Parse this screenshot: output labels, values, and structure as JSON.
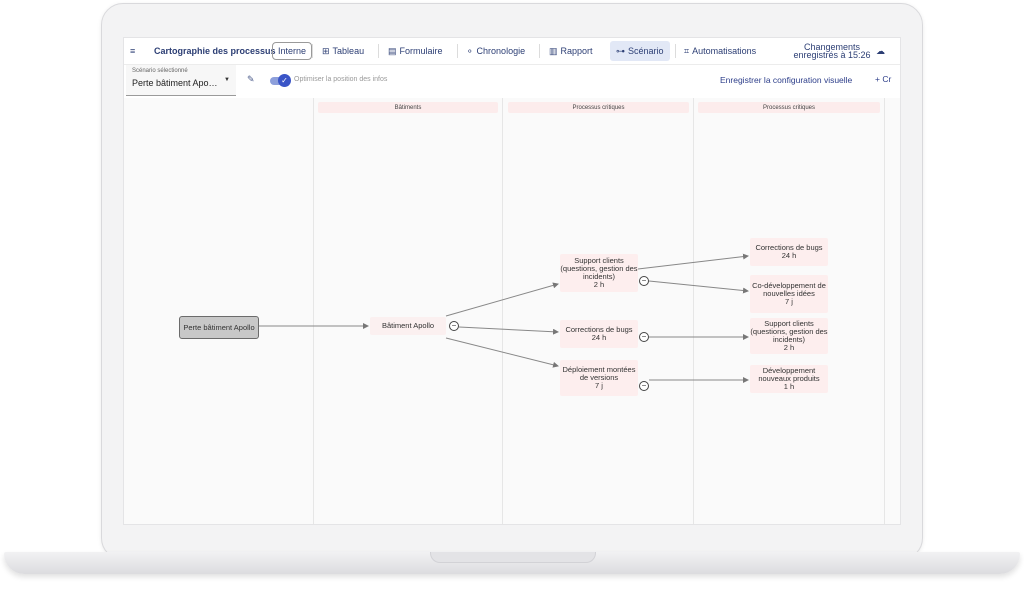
{
  "header": {
    "app_title": "Cartographie des processus",
    "badge": "Interne",
    "tabs": [
      {
        "label": "Tableau",
        "icon": "table-icon"
      },
      {
        "label": "Formulaire",
        "icon": "form-icon"
      },
      {
        "label": "Chronologie",
        "icon": "timeline-icon"
      },
      {
        "label": "Rapport",
        "icon": "report-icon"
      },
      {
        "label": "Scénario",
        "icon": "scenario-icon",
        "active": true
      },
      {
        "label": "Automatisations",
        "icon": "automation-icon"
      }
    ],
    "saved_status": "Changements enregistrés à 15:26"
  },
  "toolbar": {
    "scenario_label": "Scénario sélectionné",
    "scenario_value": "Perte bâtiment Apo…",
    "toggle_label": "Optimiser la position des infos",
    "save_config": "Enregistrer la configuration visuelle",
    "create": "Cr"
  },
  "columns": [
    "Bâtiments",
    "Processus critiques",
    "Processus critiques"
  ],
  "nodes": {
    "start": "Perte bâtiment Apollo",
    "building": "Bâtiment Apollo",
    "support": "Support clients (questions, gestion des incidents)",
    "support_time": "2 h",
    "corr1": "Corrections de bugs",
    "corr1_time": "24 h",
    "deploy": "Déploiement montées de versions",
    "deploy_time": "7 j",
    "corr2": "Corrections de bugs",
    "corr2_time": "24 h",
    "codev": "Co-développement de nouvelles idées",
    "codev_time": "7 j",
    "support2": "Support clients (questions, gestion des incidents)",
    "support2_time": "2 h",
    "newprod": "Développement nouveaux produits",
    "newprod_time": "1 h"
  },
  "colors": {
    "accent": "#2d3e8a",
    "node_bg": "#fdeeee",
    "start_bg": "#c8c8c8"
  }
}
